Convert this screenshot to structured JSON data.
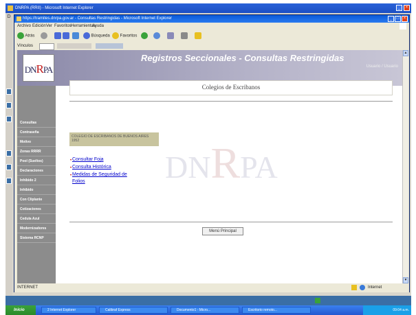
{
  "outer_window": {
    "title": "DNRPA (RRII) - Microsoft Internet Explorer"
  },
  "ie_window": {
    "title": "https://tramites.dnrpa.gov.ar - Consultas Restringidas - Microsoft Internet Explorer",
    "menu": [
      "Archivo",
      "Edición",
      "Ver",
      "Favoritos",
      "Herramientas",
      "Ayuda"
    ],
    "toolbar": {
      "back": "Atrás",
      "search": "Búsqueda",
      "favorites": "Favoritos"
    },
    "links_bar": "Vínculos",
    "status": {
      "left": "INTERNET",
      "right": "Internet"
    }
  },
  "banner": {
    "logo_left": "DN",
    "logo_r": "R",
    "logo_right": "PA",
    "title": "Registros Seccionales - Consultas Restringidas",
    "subtitle": "Usuario / Usuario"
  },
  "nav": {
    "items": [
      "Consultas",
      "Contraseña",
      "Motivo",
      "Zonas RRRR",
      "Pool (Sueltos)",
      "Declaraciones",
      "Inhibido 2",
      "Inhibido",
      "Con Cliplante",
      "Cotizaciones",
      "Cedula Azul",
      "Modernizadores",
      "Sistema RCNP"
    ]
  },
  "content": {
    "title": "Colegios de Escribanos",
    "notice": "COLEGIO DE ESCRIBANOS DE BUENOS AIRES 1952",
    "links": [
      "Consultar Foja",
      "Consulta Histórica",
      "Medidas de Seguridad de",
      "Folios"
    ],
    "watermark_left": "DN",
    "watermark_r": "R",
    "watermark_right": "PA",
    "menu_button": "Menú Principal"
  },
  "taskbar": {
    "start": "Inicio",
    "tasks": [
      "2 Internet Explorer",
      "Calibraf Express",
      "Documento1 - Micro...",
      "Escritorio remoto..."
    ],
    "clock": "09:04 a.m."
  }
}
